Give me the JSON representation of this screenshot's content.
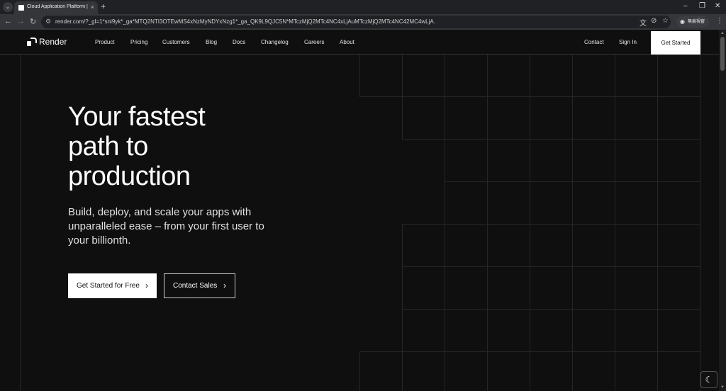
{
  "browser": {
    "tab_title": "Cloud Application Platform | R",
    "url": "render.com/?_gl=1*sni9yk*_ga*MTQ2NTI3OTEwMS4xNzMyNDYxNzg1*_ga_QK9L9QJC5N*MTczMjQ2MTc4NC4xLjAuMTczMjQ2MTc4NC42MC4wLjA.",
    "profile_label": "無痕視窗",
    "icons": {
      "tab_menu": "chevron-down-icon",
      "new_tab": "plus-icon",
      "back": "arrow-left-icon",
      "forward": "arrow-right-icon",
      "reload": "reload-icon",
      "site_info": "tune-icon",
      "translate": "translate-icon",
      "eye_off": "eye-off-icon",
      "bookmark": "star-icon",
      "menu": "kebab-icon"
    }
  },
  "nav": {
    "logo": "Render",
    "links": [
      "Product",
      "Pricing",
      "Customers",
      "Blog",
      "Docs",
      "Changelog",
      "Careers",
      "About"
    ],
    "contact": "Contact",
    "signin": "Sign In",
    "cta": "Get Started"
  },
  "hero": {
    "headline_line1": "Your fastest",
    "headline_line2": "path to",
    "headline_line3": "production",
    "subtext": "Build, deploy, and scale your apps with unparalleled ease – from your first user to your billionth.",
    "primary_cta": "Get Started for Free",
    "secondary_cta": "Contact Sales"
  },
  "theme_toggle": {
    "icon": "moon-icon"
  }
}
